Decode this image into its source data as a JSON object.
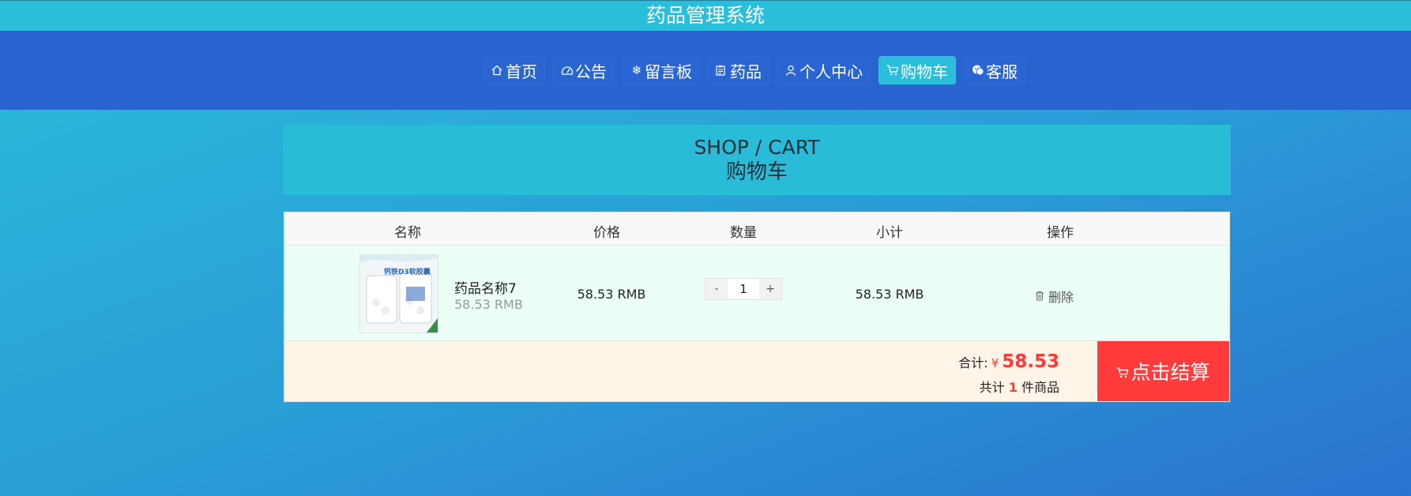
{
  "app": {
    "title": "药品管理系统"
  },
  "nav": {
    "items": [
      {
        "label": "首页",
        "icon": "home-icon"
      },
      {
        "label": "公告",
        "icon": "gauge-icon"
      },
      {
        "label": "留言板",
        "icon": "snowflake-icon"
      },
      {
        "label": "药品",
        "icon": "clipboard-icon"
      },
      {
        "label": "个人中心",
        "icon": "user-icon"
      },
      {
        "label": "购物车",
        "icon": "cart-icon",
        "active": true
      },
      {
        "label": "客服",
        "icon": "wechat-icon"
      }
    ]
  },
  "page": {
    "heading_en": "SHOP / CART",
    "heading_zh": "购物车"
  },
  "cart": {
    "columns": [
      "名称",
      "价格",
      "数量",
      "小计",
      "操作"
    ],
    "items": [
      {
        "name": "药品名称7",
        "price_sub": "58.53 RMB",
        "price": "58.53 RMB",
        "quantity": "1",
        "subtotal": "58.53 RMB",
        "delete_label": "删除",
        "thumb_text": "钙铁D3软胶囊"
      }
    ],
    "qty_minus": "-",
    "qty_plus": "+",
    "summary": {
      "total_label": "合计:",
      "currency": "¥",
      "total_amount": "58.53",
      "count_prefix": "共计",
      "count": "1",
      "count_suffix": "件商品"
    },
    "checkout_label": "点击结算"
  },
  "colors": {
    "header": "#29bed9",
    "nav": "#2864cf",
    "accent_red": "#ff3b3b",
    "row_bg": "#ecfff6",
    "footer_bg": "#fff4e8"
  }
}
